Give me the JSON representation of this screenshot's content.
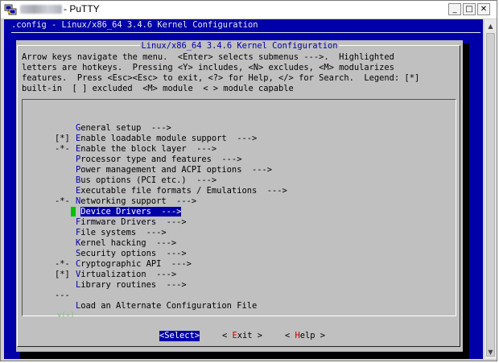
{
  "window": {
    "app_name": "- PuTTY",
    "controls": {
      "minimize": "_",
      "maximize": "□",
      "close": "✕"
    }
  },
  "terminal": {
    "header": ".config - Linux/x86_64 3.4.6 Kernel Configuration",
    "dialog_title": "Linux/x86_64 3.4.6 Kernel Configuration",
    "help_lines": [
      "Arrow keys navigate the menu.  <Enter> selects submenus --->.  Highlighted",
      "letters are hotkeys.  Pressing <Y> includes, <N> excludes, <M> modularizes",
      "features.  Press <Esc><Esc> to exit, <?> for Help, </> for Search.  Legend: [*]",
      "built-in  [ ] excluded  <M> module  < > module capable"
    ],
    "menu": [
      {
        "prefix": "",
        "hot": "G",
        "rest": "eneral setup  --->"
      },
      {
        "prefix": "[*]",
        "hot": "E",
        "rest": "nable loadable module support  --->"
      },
      {
        "prefix": "-*-",
        "hot": "E",
        "rest": "nable the block layer  --->"
      },
      {
        "prefix": "",
        "hot": "P",
        "rest": "rocessor type and features  --->"
      },
      {
        "prefix": "",
        "hot": "P",
        "rest": "ower management and ACPI options  --->"
      },
      {
        "prefix": "",
        "hot": "B",
        "rest": "us options (PCI etc.)  --->"
      },
      {
        "prefix": "",
        "hot": "E",
        "rest": "xecutable file formats / Emulations  --->"
      },
      {
        "prefix": "-*-",
        "hot": "N",
        "rest": "etworking support  --->"
      },
      {
        "prefix": "",
        "hot": "D",
        "rest": "evice Drivers  --->",
        "selected": true
      },
      {
        "prefix": "",
        "hot": "F",
        "rest": "irmware Drivers  --->"
      },
      {
        "prefix": "",
        "hot": "F",
        "rest": "ile systems  --->"
      },
      {
        "prefix": "",
        "hot": "K",
        "rest": "ernel hacking  --->"
      },
      {
        "prefix": "",
        "hot": "S",
        "rest": "ecurity options  --->"
      },
      {
        "prefix": "-*-",
        "hot": "C",
        "rest": "ryptographic API  --->"
      },
      {
        "prefix": "[*]",
        "hot": "V",
        "rest": "irtualization  --->"
      },
      {
        "prefix": "",
        "hot": "L",
        "rest": "ibrary routines  --->"
      },
      {
        "prefix": "---",
        "hot": "",
        "rest": ""
      },
      {
        "prefix": "",
        "hot": "L",
        "rest": "oad an Alternate Configuration File"
      }
    ],
    "more_marker": "v(+)",
    "buttons": {
      "select": {
        "pre": "<",
        "hot": "S",
        "rest": "elect>"
      },
      "exit": {
        "pre": "< ",
        "hot": "E",
        "rest": "xit >"
      },
      "help": {
        "pre": "< ",
        "hot": "H",
        "rest": "elp >"
      }
    }
  },
  "colors": {
    "terminal_bg": "#0000a8",
    "dialog_bg": "#c0c0c0",
    "selection_bg": "#0000a8",
    "hotkey_menu": "#0000a8",
    "hotkey_button": "#c00000",
    "cursor": "#00c000"
  }
}
